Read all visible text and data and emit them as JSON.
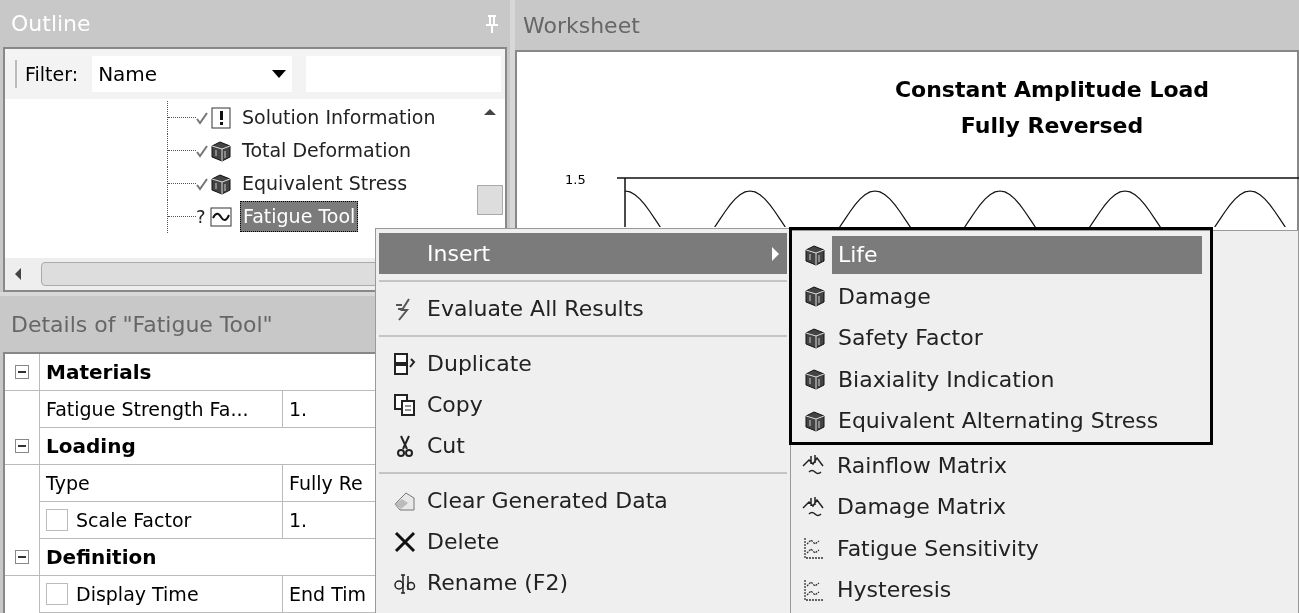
{
  "outline": {
    "title": "Outline",
    "filter": {
      "label": "Filter:",
      "value": "Name"
    },
    "tree": [
      {
        "label": "Solution Information",
        "kind": "info",
        "solved": true,
        "selected": false
      },
      {
        "label": "Total Deformation",
        "kind": "result",
        "solved": true,
        "selected": false
      },
      {
        "label": "Equivalent Stress",
        "kind": "result",
        "solved": true,
        "selected": false
      },
      {
        "label": "Fatigue Tool",
        "kind": "tool",
        "solved": false,
        "status_text": "?",
        "selected": true
      }
    ]
  },
  "details": {
    "title": "Details of \"Fatigue Tool\"",
    "sections": [
      {
        "title": "Materials",
        "expanded": true,
        "rows": [
          {
            "kind": "plain",
            "name": "Fatigue Strength Fa...",
            "value": "1."
          }
        ]
      },
      {
        "title": "Loading",
        "expanded": true,
        "rows": [
          {
            "kind": "plain",
            "name": "Type",
            "value": "Fully Re"
          },
          {
            "kind": "param",
            "checked": false,
            "name": "Scale Factor",
            "value": "1."
          }
        ]
      },
      {
        "title": "Definition",
        "expanded": true,
        "rows": [
          {
            "kind": "param",
            "checked": false,
            "name": "Display Time",
            "value": "End Tim"
          }
        ]
      }
    ]
  },
  "worksheet": {
    "title": "Worksheet",
    "chart_title": [
      "Constant Amplitude Load",
      "Fully Reversed"
    ],
    "y_tick": "1.5"
  },
  "context_menu": {
    "items": [
      {
        "kind": "insert",
        "label": "Insert",
        "selected": true,
        "submenu": true
      },
      {
        "kind": "separator"
      },
      {
        "kind": "evaluate",
        "label": "Evaluate All Results",
        "selected": false
      },
      {
        "kind": "separator"
      },
      {
        "kind": "duplicate",
        "label": "Duplicate",
        "selected": false
      },
      {
        "kind": "copy",
        "label": "Copy",
        "selected": false
      },
      {
        "kind": "cut",
        "label": "Cut",
        "selected": false
      },
      {
        "kind": "separator"
      },
      {
        "kind": "clear",
        "label": "Clear Generated Data",
        "selected": false
      },
      {
        "kind": "delete",
        "label": "Delete",
        "selected": false
      },
      {
        "kind": "rename",
        "label": "Rename (F2)",
        "selected": false
      }
    ]
  },
  "submenu": {
    "items": [
      {
        "label": "Life",
        "kind": "result",
        "selected": true
      },
      {
        "label": "Damage",
        "kind": "result",
        "selected": false
      },
      {
        "label": "Safety Factor",
        "kind": "result",
        "selected": false
      },
      {
        "label": "Biaxiality Indication",
        "kind": "result",
        "selected": false
      },
      {
        "label": "Equivalent Alternating Stress",
        "kind": "result",
        "selected": false
      },
      {
        "label": "Rainflow Matrix",
        "kind": "matrix",
        "selected": false
      },
      {
        "label": "Damage Matrix",
        "kind": "matrix",
        "selected": false
      },
      {
        "label": "Fatigue Sensitivity",
        "kind": "graph",
        "selected": false
      },
      {
        "label": "Hysteresis",
        "kind": "graph",
        "selected": false
      }
    ]
  }
}
